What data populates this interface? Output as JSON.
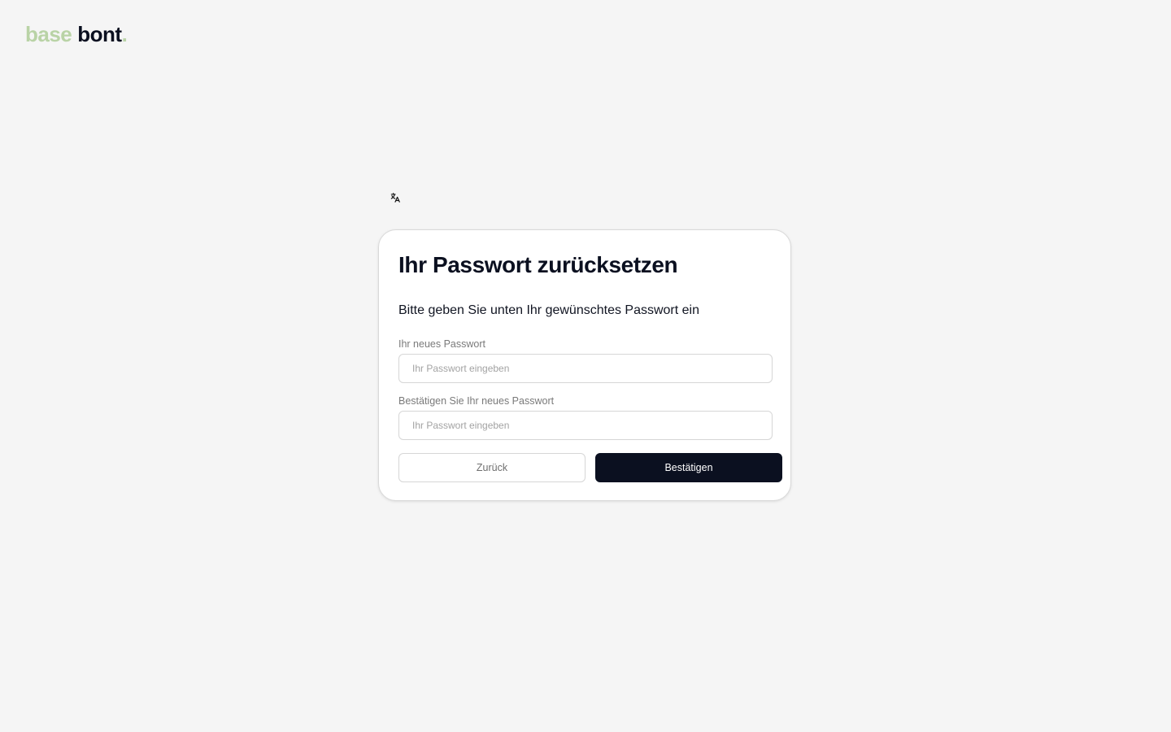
{
  "brand": {
    "part1": "base",
    "part2": "bont",
    "dot": ".",
    "accent_color": "#b9d3a6",
    "dark_color": "#0b1020"
  },
  "language_switcher": {
    "icon": "translate-icon"
  },
  "reset_card": {
    "title": "Ihr Passwort zurücksetzen",
    "subtitle": "Bitte geben Sie unten Ihr gewünschtes Passwort ein",
    "new_password": {
      "label": "Ihr neues Passwort",
      "placeholder": "Ihr Passwort eingeben",
      "value": ""
    },
    "confirm_password": {
      "label": "Bestätigen Sie Ihr neues Passwort",
      "placeholder": "Ihr Passwort eingeben",
      "value": ""
    },
    "back_button": "Zurück",
    "confirm_button": "Bestätigen"
  }
}
